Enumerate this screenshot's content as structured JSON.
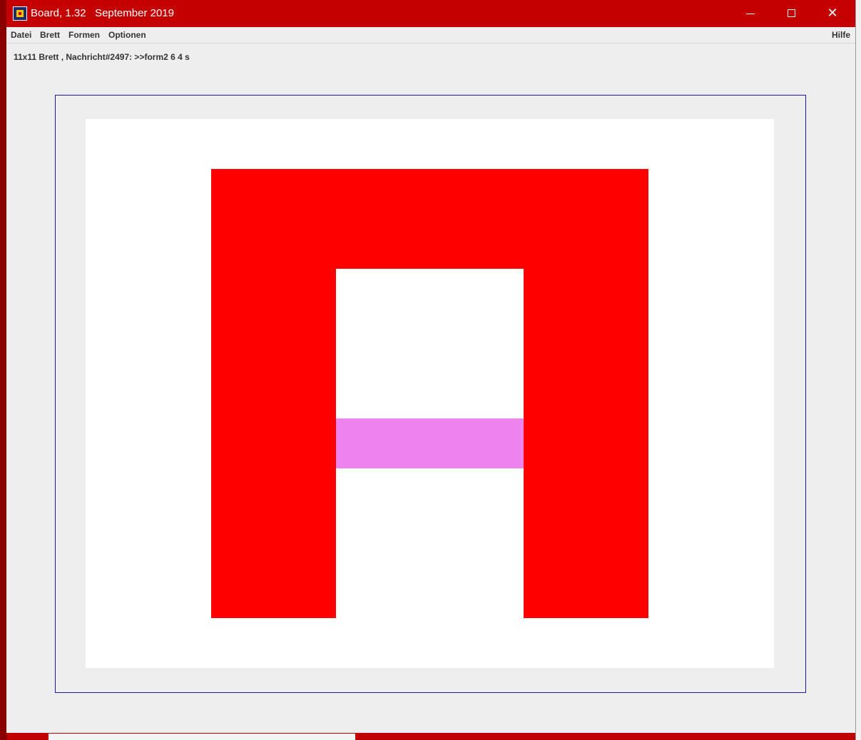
{
  "window": {
    "title": "Board, 1.32   September 2019",
    "icon": "board-app-icon",
    "controls": {
      "minimize": "minimize-icon",
      "maximize": "maximize-icon",
      "close": "close-icon"
    }
  },
  "menubar": {
    "items": [
      "Datei",
      "Brett",
      "Formen",
      "Optionen"
    ],
    "help": "Hilfe"
  },
  "status": {
    "text": "11x11 Brett , Nachricht#2497: >>form2 6 4 s"
  },
  "board": {
    "grid_size": "11x11",
    "colors": {
      "background": "#ffffff",
      "shape": "#ff0000",
      "accent": "#ee82ee",
      "frame": "#1a1aa8"
    }
  }
}
